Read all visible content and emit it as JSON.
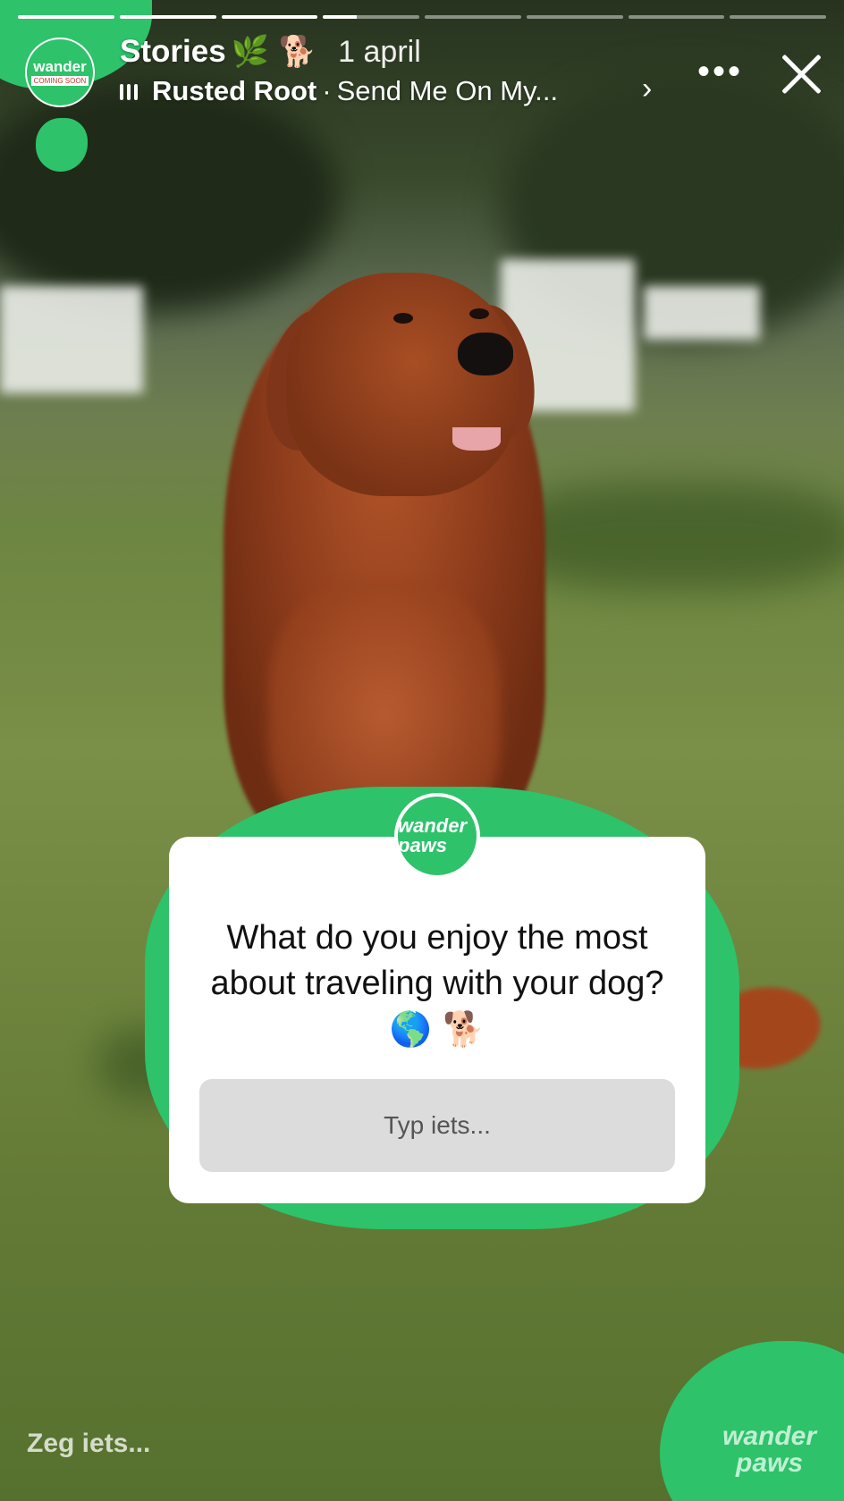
{
  "progress": {
    "segments": 8,
    "active_index": 3,
    "active_fraction": 0.35
  },
  "account": {
    "avatar_wordmark": "wander",
    "avatar_badge": "COMING SOON",
    "name": "Stories",
    "name_emoji": "🌿 🐕",
    "date": "1 april"
  },
  "music": {
    "artist": "Rusted Root",
    "separator": "·",
    "track": "Send Me On My...",
    "chevron": "›"
  },
  "controls": {
    "more": "•••"
  },
  "sticker": {
    "logo_text": "wander paws",
    "question": "What do you enjoy the most about traveling with your dog?",
    "question_emoji": "🌎 🐕",
    "placeholder": "Typ iets..."
  },
  "corner_logo": {
    "line1": "wander",
    "line2": "paws"
  },
  "reply": {
    "placeholder": "Zeg iets..."
  },
  "colors": {
    "brand_green": "#2ec26a"
  }
}
